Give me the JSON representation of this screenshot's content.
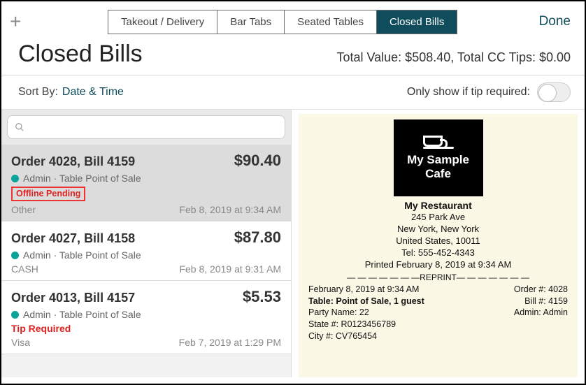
{
  "header": {
    "plus": "+",
    "tabs": [
      "Takeout / Delivery",
      "Bar Tabs",
      "Seated Tables",
      "Closed Bills"
    ],
    "active_tab": 3,
    "done": "Done"
  },
  "page": {
    "title": "Closed Bills",
    "totals": "Total Value: $508.40, Total CC Tips: $0.00"
  },
  "controls": {
    "sort_label": "Sort By:",
    "sort_value": "Date & Time",
    "tip_filter_label": "Only show if tip required:",
    "search_placeholder": ""
  },
  "bills": [
    {
      "title": "Order 4028, Bill 4159",
      "amount": "$90.40",
      "author": "Admin · Table Point of Sale",
      "badge": "Offline Pending",
      "tip_required": "",
      "method": "Other",
      "time": "Feb 8, 2019 at 9:34 AM",
      "selected": true
    },
    {
      "title": "Order 4027, Bill 4158",
      "amount": "$87.80",
      "author": "Admin · Table Point of Sale",
      "badge": "",
      "tip_required": "",
      "method": "CASH",
      "time": "Feb 8, 2019 at 9:31 AM",
      "selected": false
    },
    {
      "title": "Order 4013, Bill 4157",
      "amount": "$5.53",
      "author": "Admin · Table Point of Sale",
      "badge": "",
      "tip_required": "Tip Required",
      "method": "Visa",
      "time": "Feb 7, 2019 at 1:29 PM",
      "selected": false
    }
  ],
  "receipt": {
    "brand_line1": "My Sample",
    "brand_line2": "Cafe",
    "name": "My Restaurant",
    "addr1": "245 Park Ave",
    "addr2": "New York, New York",
    "addr3": "United States, 10011",
    "tel": "Tel: 555-452-4343",
    "printed": "Printed February 8, 2019 at 9:34 AM",
    "reprint_divider": "— — — — — — —REPRINT— — — — — — —",
    "left_lines": [
      "February 8, 2019 at 9:34 AM",
      "Table: Point of Sale, 1 guest",
      "Party Name: 22",
      "State #: R0123456789",
      "City #: CV765454"
    ],
    "right_lines": [
      "Order #:  4028",
      "Bill #:  4159",
      "Admin: Admin"
    ]
  }
}
